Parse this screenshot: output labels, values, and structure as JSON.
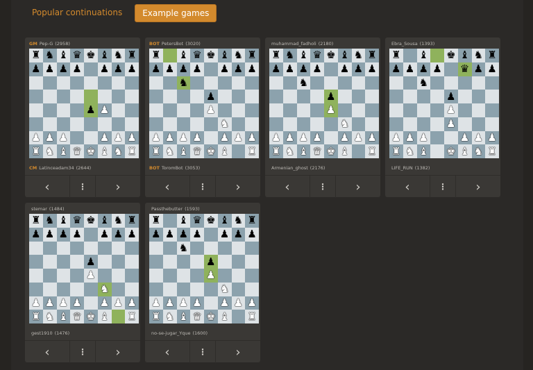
{
  "tabs": [
    {
      "label": "Popular continuations",
      "active": false
    },
    {
      "label": "Example games",
      "active": true
    }
  ],
  "controls": {
    "prev": "‹",
    "menu": "⋮",
    "next": "›"
  },
  "games": [
    {
      "top": {
        "title": "GM",
        "name": "Pep-G",
        "rating": "(2958)"
      },
      "bottom": {
        "title": "CM",
        "name": "Latinceadam34",
        "rating": "(2644)"
      },
      "board": [
        "rnbqkbnr",
        "pppp.ppp",
        "........",
        "........",
        "....pP..",
        "........",
        "PPP..PPP",
        "RNBQKBNR"
      ],
      "highlight": [
        "e4",
        "e5"
      ]
    },
    {
      "top": {
        "title": "BOT",
        "name": "PetersBot",
        "rating": "(3020)"
      },
      "bottom": {
        "title": "BOT",
        "name": "ToromBot",
        "rating": "(3053)"
      },
      "board": [
        "r.bqkbnr",
        "pppp.ppp",
        "..n.....",
        "....p...",
        "....P...",
        ".....N..",
        "PPPP.PPP",
        "RNBQKB.R"
      ],
      "highlight": [
        "b8",
        "c6"
      ]
    },
    {
      "top": {
        "title": "",
        "name": "muhammad_fadholi",
        "rating": "(2180)"
      },
      "bottom": {
        "title": "",
        "name": "Armenian_ghost",
        "rating": "(2176)"
      },
      "board": [
        "rnbqkbnr",
        "pppp.ppp",
        "..n.....",
        "....p...",
        "....P...",
        ".....N..",
        "PPPP.PPP",
        "RNBQKB.R"
      ],
      "highlight": [
        "e4",
        "e5"
      ]
    },
    {
      "top": {
        "title": "",
        "name": "Ebra_Sousa",
        "rating": "(1393)"
      },
      "bottom": {
        "title": "",
        "name": "LIFE_RUN",
        "rating": "(1382)"
      },
      "board": [
        "r.b.kbnr",
        "pppp.qpp",
        "..n.....",
        "....p...",
        "....P...",
        "....P...",
        "PPP..PPP",
        "RNB.KBNR"
      ],
      "highlight": [
        "d8",
        "f7"
      ]
    },
    {
      "top": {
        "title": "",
        "name": "stemar",
        "rating": "(1484)"
      },
      "bottom": {
        "title": "",
        "name": "gest1910",
        "rating": "(1476)"
      },
      "board": [
        "rnbqkbnr",
        "pppp.ppp",
        "........",
        "....p...",
        "....P...",
        ".....N..",
        "PPPP.PPP",
        "RNBQKB.R"
      ],
      "highlight": [
        "g1",
        "f3"
      ]
    },
    {
      "top": {
        "title": "",
        "name": "Passthebutter",
        "rating": "(1593)"
      },
      "bottom": {
        "title": "",
        "name": "no-se-jugar_Yque",
        "rating": "(1600)"
      },
      "board": [
        "r.bqkbnr",
        "pppp.ppp",
        "..n.....",
        "....p...",
        "....P...",
        ".....N..",
        "PPPP.PPP",
        "RNBQKB.R"
      ],
      "highlight": [
        "e4",
        "e5"
      ]
    }
  ]
}
